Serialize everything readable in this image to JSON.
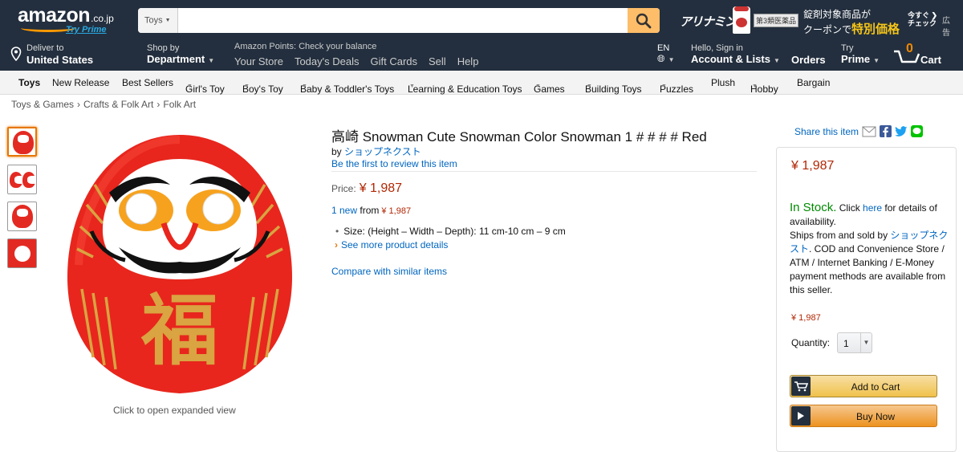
{
  "header": {
    "logo_text": "amazon",
    "logo_tld": ".co.jp",
    "try_prime": "Try Prime",
    "search_category": "Toys",
    "search_value": "",
    "promo": {
      "brand": "アリナミン",
      "tag": "第3類医薬品",
      "line1": "錠剤対象商品が",
      "line2_prefix": "クーポンで",
      "line2_bold": "特別価格",
      "now_check_1": "今すぐ",
      "now_check_2": "チェック",
      "ad": "広告"
    }
  },
  "nav": {
    "deliver_small": "Deliver to",
    "deliver_bold": "United States",
    "shopby_small": "Shop by",
    "shopby_bold": "Department",
    "points": "Amazon Points: Check your balance",
    "links": [
      "Your Store",
      "Today's Deals",
      "Gift Cards",
      "Sell",
      "Help"
    ],
    "lang": "EN",
    "signin_small": "Hello, Sign in",
    "signin_bold": "Account & Lists",
    "orders": "Orders",
    "prime_small": "Try",
    "prime_bold": "Prime",
    "cart_count": "0",
    "cart_label": "Cart"
  },
  "belt": {
    "items": [
      "Toys",
      "New Release",
      "Best Sellers",
      "Girl's Toy",
      "Boy's Toy",
      "Baby & Toddler's Toys",
      "Learning & Education Toys",
      "Games",
      "Building Toys",
      "Puzzles",
      "Plush",
      "Hobby",
      "Bargain"
    ]
  },
  "breadcrumb": [
    "Toys & Games",
    "Crafts & Folk Art",
    "Folk Art"
  ],
  "gallery": {
    "caption": "Click to open expanded view",
    "main_char": "福"
  },
  "product": {
    "title": "高崎 Snowman Cute Snowman Color Snowman 1 # # # # Red",
    "by_label": "by",
    "seller": "ショップネクスト",
    "review_link": "Be the first to review this item",
    "price_label": "Price:",
    "price": "¥ 1,987",
    "new_count": "1 new",
    "new_from": "from",
    "new_price": "¥ 1,987",
    "size_bullet": "Size: (Height – Width – Depth): 11 cm-10 cm – 9 cm",
    "more_details": "See more product details",
    "compare": "Compare with similar items"
  },
  "share": {
    "label": "Share this item"
  },
  "buybox": {
    "price": "¥ 1,987",
    "in_stock": "In Stock.",
    "click": "Click",
    "here": "here",
    "for_details": "for details of availability.",
    "ships_from": "Ships from and sold by",
    "seller": "ショップネクスト",
    "rest": ". COD and Convenience Store / ATM / Internet Banking / E-Money payment methods are available from this seller.",
    "price2": "¥ 1,987",
    "qty_label": "Quantity:",
    "qty_value": "1",
    "add_to_cart": "Add to Cart",
    "buy_now": "Buy Now"
  }
}
